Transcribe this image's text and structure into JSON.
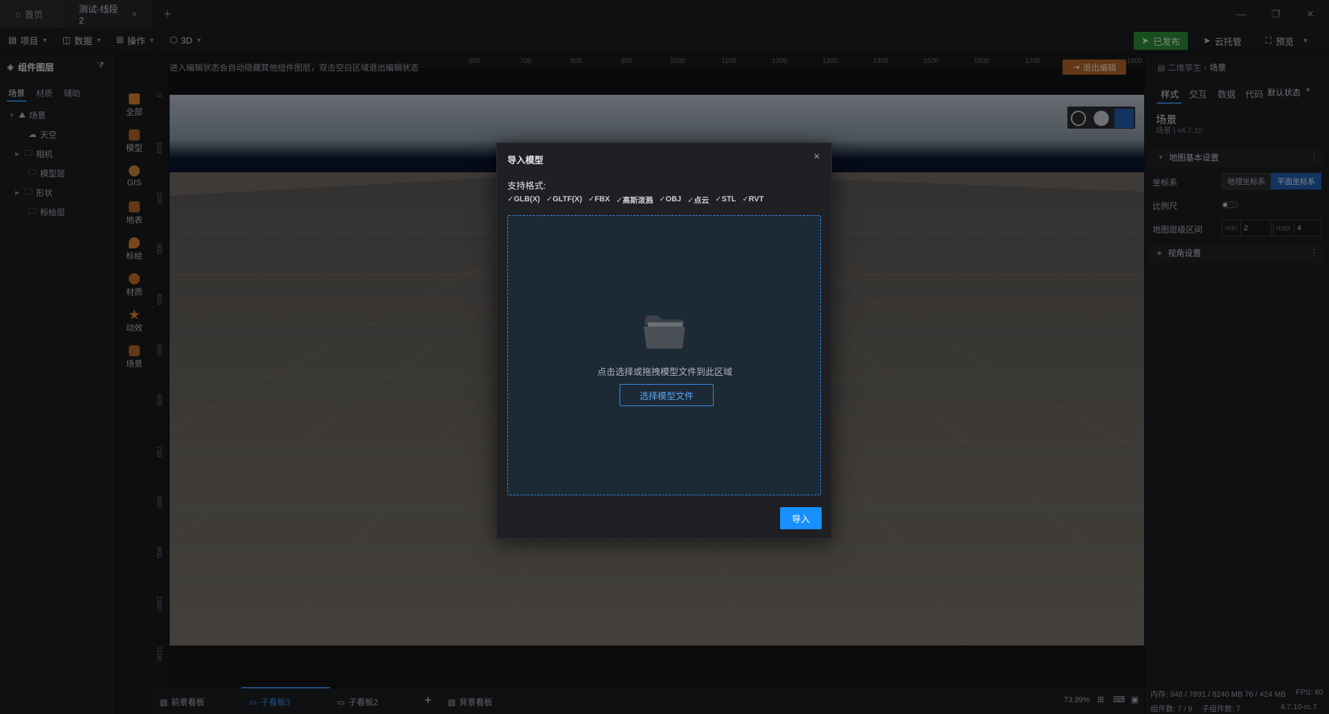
{
  "window": {
    "tabs": [
      {
        "label": "首页"
      },
      {
        "label": "测试-线段2"
      }
    ]
  },
  "menu": {
    "items": [
      "项目",
      "数据",
      "操作",
      "3D"
    ],
    "publish_label": "已发布",
    "cloud_label": "云托管",
    "preview_label": "预览"
  },
  "left_panel": {
    "title": "组件图层",
    "tabs": [
      "场景",
      "材质",
      "辅助"
    ],
    "tree": [
      {
        "label": "场景",
        "level": 0,
        "expandable": true,
        "expanded": true
      },
      {
        "label": "天空",
        "level": 1,
        "expandable": false
      },
      {
        "label": "相机",
        "level": 1,
        "expandable": true
      },
      {
        "label": "模型层",
        "level": 1,
        "expandable": false
      },
      {
        "label": "形状",
        "level": 1,
        "expandable": true
      },
      {
        "label": "标绘层",
        "level": 1,
        "expandable": false
      }
    ]
  },
  "icon_column": [
    {
      "label": "全部",
      "icon": "grid-icon",
      "color": "#d9822b"
    },
    {
      "label": "模型",
      "icon": "model-icon",
      "color": "#b5652a"
    },
    {
      "label": "GIS",
      "icon": "globe-icon",
      "color": "#c98a3a"
    },
    {
      "label": "地表",
      "icon": "terrain-icon",
      "color": "#b5652a"
    },
    {
      "label": "标绘",
      "icon": "marker-icon",
      "color": "#d9822b"
    },
    {
      "label": "材质",
      "icon": "material-icon",
      "color": "#c9702a"
    },
    {
      "label": "动效",
      "icon": "effect-icon",
      "color": "#d9822b"
    },
    {
      "label": "场景",
      "icon": "scene-icon",
      "color": "#b5652a"
    }
  ],
  "canvas": {
    "hint": "进入编辑状态会自动隐藏其他组件图层，双击空白区域退出编辑状态",
    "exit_label": "退出编辑",
    "ruler_top": [
      "600",
      "700",
      "800",
      "900",
      "1000",
      "1100",
      "1200",
      "1300",
      "1400",
      "1500",
      "1600",
      "1700",
      "1900"
    ],
    "ruler_left": [
      "0",
      "100",
      "200",
      "300",
      "400",
      "500",
      "600",
      "700",
      "800",
      "900",
      "1000",
      "1100"
    ]
  },
  "modal": {
    "title": "导入模型",
    "formats_title": "支持格式:",
    "formats": [
      "✓GLB(X)",
      "✓GLTF(X)",
      "✓FBX",
      "✓高斯泼溅",
      "✓OBJ",
      "✓点云",
      "✓STL",
      "✓RVT"
    ],
    "drop_text": "点击选择或拖拽模型文件到此区域",
    "choose_label": "选择模型文件",
    "import_label": "导入"
  },
  "right_panel": {
    "crumb_parent": "二维孪生",
    "crumb_current": "场景",
    "tabs": [
      "样式",
      "交互",
      "数据",
      "代码"
    ],
    "state_label": "默认状态",
    "component_name": "场景",
    "component_version": "场景 | v4.7.10",
    "section_map": "地图基本设置",
    "coord_label": "坐标系",
    "coord_geo": "地理坐标系",
    "coord_plane": "平面坐标系",
    "scale_label": "比例尺",
    "range_label": "地图层级区间",
    "min_prefix": "min",
    "min_value": "2",
    "max_prefix": "max",
    "max_value": "4",
    "section_view": "视角设置",
    "stats_mem": "内存: 348 / 7891 / 8240 MB  76 / 424 MB",
    "stats_fps": "FPS: 60",
    "stats_components": "组件数: 7 / 9",
    "stats_sub": "子组件数: 7",
    "stats_version": "4.7.10-rc.7"
  },
  "boards": {
    "tabs": [
      {
        "label": "前景看板"
      },
      {
        "label": "子看板3"
      },
      {
        "label": "子看板2"
      },
      {
        "label": "背景看板"
      }
    ],
    "zoom": "73.39%"
  }
}
